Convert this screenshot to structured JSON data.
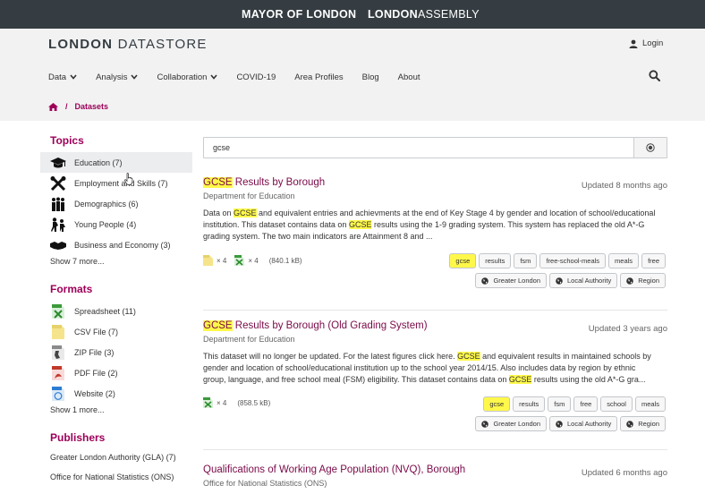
{
  "topbar": {
    "mayor": "MAYOR OF LONDON",
    "assembly_bold": "LONDON",
    "assembly_rest": "ASSEMBLY"
  },
  "header": {
    "logo_bold": "LONDON",
    "logo_rest": " DATASTORE",
    "login": "Login",
    "nav": [
      {
        "label": "Data",
        "dropdown": true
      },
      {
        "label": "Analysis",
        "dropdown": true
      },
      {
        "label": "Collaboration",
        "dropdown": true
      },
      {
        "label": "COVID-19",
        "dropdown": false
      },
      {
        "label": "Area Profiles",
        "dropdown": false
      },
      {
        "label": "Blog",
        "dropdown": false
      },
      {
        "label": "About",
        "dropdown": false
      }
    ]
  },
  "breadcrumb": {
    "separator": "/",
    "current": "Datasets"
  },
  "colors": {
    "accent": "#9e0059",
    "title": "#7a0a48",
    "highlight": "#fff84a",
    "topbar": "#353d42"
  },
  "sidebar": {
    "topics_heading": "Topics",
    "topics": [
      {
        "label": "Education (7)",
        "icon": "graduation-cap-icon"
      },
      {
        "label": "Employment and Skills (7)",
        "icon": "tools-icon"
      },
      {
        "label": "Demographics (6)",
        "icon": "people-icon"
      },
      {
        "label": "Young People (4)",
        "icon": "children-icon"
      },
      {
        "label": "Business and Economy (3)",
        "icon": "handshake-icon"
      }
    ],
    "topics_more": "Show 7 more...",
    "formats_heading": "Formats",
    "formats": [
      {
        "label": "Spreadsheet (11)",
        "icon": "spreadsheet-icon"
      },
      {
        "label": "CSV File (7)",
        "icon": "csv-file-icon"
      },
      {
        "label": "ZIP File (3)",
        "icon": "zip-file-icon"
      },
      {
        "label": "PDF File (2)",
        "icon": "pdf-file-icon"
      },
      {
        "label": "Website (2)",
        "icon": "website-icon"
      }
    ],
    "formats_more": "Show 1 more...",
    "publishers_heading": "Publishers",
    "publishers": [
      {
        "label": "Greater London Authority (GLA) (7)"
      },
      {
        "label": "Office for National Statistics (ONS)"
      }
    ]
  },
  "search": {
    "value": "gcse"
  },
  "results": [
    {
      "title_hl": "GCSE",
      "title_rest": " Results by Borough",
      "updated": "Updated 8 months ago",
      "publisher": "Department for Education",
      "desc": [
        {
          "t": "Data on "
        },
        {
          "t": "GCSE",
          "hl": true
        },
        {
          "t": " and equivalent entries and achievments at the end of Key Stage 4 by gender and location of school/educational institution. This dataset contains data on "
        },
        {
          "t": "GCSE",
          "hl": true
        },
        {
          "t": " results using the 1-9 grading system. This system has replaced the old A*-G grading system. The two main indicators are Attainment 8 and ..."
        }
      ],
      "file_counts": [
        "× 4",
        "× 4"
      ],
      "size": "(840.1 kB)",
      "tags": [
        "gcse",
        "results",
        "fsm",
        "free-school-meals",
        "meals",
        "free"
      ],
      "regions": [
        "Greater London",
        "Local Authority",
        "Region"
      ]
    },
    {
      "title_hl": "GCSE",
      "title_rest": " Results by Borough (Old Grading System)",
      "updated": "Updated 3 years ago",
      "publisher": "Department for Education",
      "desc": [
        {
          "t": "This dataset will no longer be updated. For the latest figures click here. "
        },
        {
          "t": "GCSE",
          "hl": true
        },
        {
          "t": " and equivalent results in maintained schools by gender and location of school/educational institution up to the school year 2014/15. Also includes data by region by ethnic group, language, and free school meal (FSM) eligibility. This dataset contains data on "
        },
        {
          "t": "GCSE",
          "hl": true
        },
        {
          "t": " results using the old A*-G gra..."
        }
      ],
      "file_counts": [
        "× 4"
      ],
      "size": "(858.5 kB)",
      "tags": [
        "gcse",
        "results",
        "fsm",
        "free",
        "school",
        "meals"
      ],
      "regions": [
        "Greater London",
        "Local Authority",
        "Region"
      ]
    },
    {
      "title": "Qualifications of Working Age Population (NVQ), Borough",
      "updated": "Updated 6 months ago",
      "publisher": "Office for National Statistics (ONS)"
    }
  ]
}
